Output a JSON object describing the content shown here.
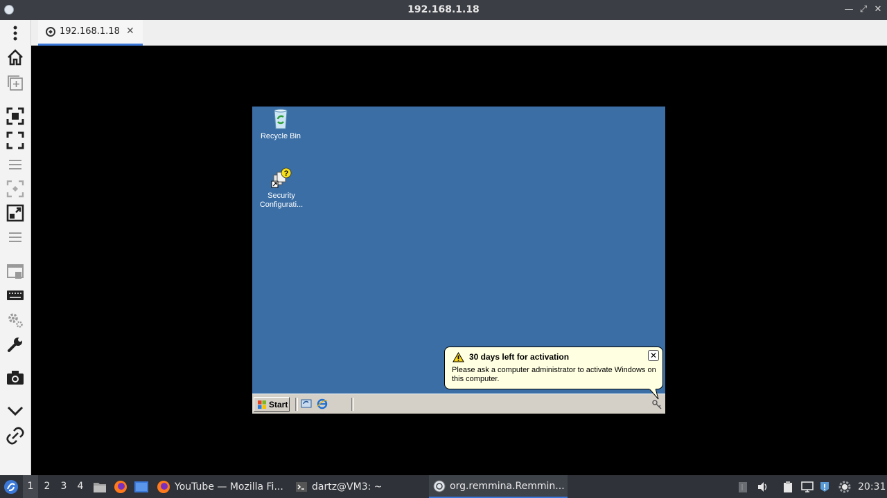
{
  "window": {
    "title": "192.168.1.18"
  },
  "tab": {
    "label": "192.168.1.18",
    "close_glyph": "✕"
  },
  "remote_desktop": {
    "icons": [
      {
        "label_line1": "Recycle Bin",
        "label_line2": ""
      },
      {
        "label_line1": "Security",
        "label_line2": "Configurati..."
      }
    ],
    "start_label": "Start",
    "balloon": {
      "title": "30 days left for activation",
      "body": "Please ask a computer administrator to activate Windows on this computer."
    },
    "desktop_color": "#3a6ea5"
  },
  "panel": {
    "workspaces": [
      "1",
      "2",
      "3",
      "4"
    ],
    "tasks": [
      {
        "label": "YouTube — Mozilla Fi..."
      },
      {
        "label": "dartz@VM3: ~"
      },
      {
        "label": "org.remmina.Remmin..."
      }
    ],
    "clock": "20:31"
  },
  "colors": {
    "accent": "#3b78d8",
    "balloon_bg": "#ffffe1"
  }
}
